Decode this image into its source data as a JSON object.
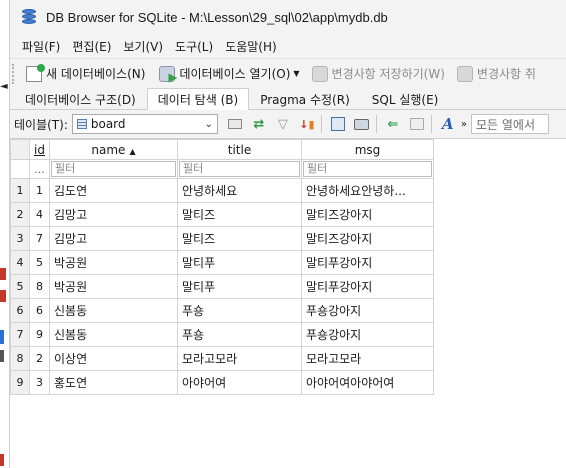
{
  "window": {
    "title": "DB Browser for SQLite - M:\\Lesson\\29_sql\\02\\app\\mydb.db"
  },
  "menu": [
    "파일(F)",
    "편집(E)",
    "보기(V)",
    "도구(L)",
    "도움말(H)"
  ],
  "toolbar": {
    "new_db": "새 데이터베이스(N)",
    "open_db": "데이터베이스 열기(O)",
    "write_changes": "변경사항 저장하기(W)",
    "revert_changes": "변경사항 취"
  },
  "tabs": [
    "데이터베이스 구조(D)",
    "데이터 탐색 (B)",
    "Pragma 수정(R)",
    "SQL 실행(E)"
  ],
  "active_tab": 1,
  "table_bar": {
    "label": "테이블(T):",
    "selected_table": "board",
    "filter_all": "모든 열에서 ",
    "more": "»"
  },
  "grid": {
    "columns": [
      "id",
      "name",
      "title",
      "msg"
    ],
    "sorted_column": "name",
    "sort_glyph": "▲",
    "corner_dots": "...",
    "filter_placeholder": "필터",
    "rows": [
      {
        "num": "1",
        "id": "1",
        "name": "김도연",
        "title": "안녕하세요",
        "msg": "안녕하세요안녕하..."
      },
      {
        "num": "2",
        "id": "4",
        "name": "김망고",
        "title": "말티즈",
        "msg": "말티즈강아지"
      },
      {
        "num": "3",
        "id": "7",
        "name": "김망고",
        "title": "말티즈",
        "msg": "말티즈강아지"
      },
      {
        "num": "4",
        "id": "5",
        "name": "박공원",
        "title": "말티푸",
        "msg": "말티푸강아지"
      },
      {
        "num": "5",
        "id": "8",
        "name": "박공원",
        "title": "말티푸",
        "msg": "말티푸강아지"
      },
      {
        "num": "6",
        "id": "6",
        "name": "신봄동",
        "title": "푸숑",
        "msg": "푸숑강아지"
      },
      {
        "num": "7",
        "id": "9",
        "name": "신봄동",
        "title": "푸숑",
        "msg": "푸숑강아지"
      },
      {
        "num": "8",
        "id": "2",
        "name": "이상연",
        "title": "모라고모라",
        "msg": "모라고모라"
      },
      {
        "num": "9",
        "id": "3",
        "name": "홍도연",
        "title": "아야어여",
        "msg": "아야어여아야어여"
      }
    ]
  },
  "colors": {
    "accent": "#3f7fd6",
    "window_bg": "#f3f3f3",
    "grid_border": "#d4d4d4"
  }
}
